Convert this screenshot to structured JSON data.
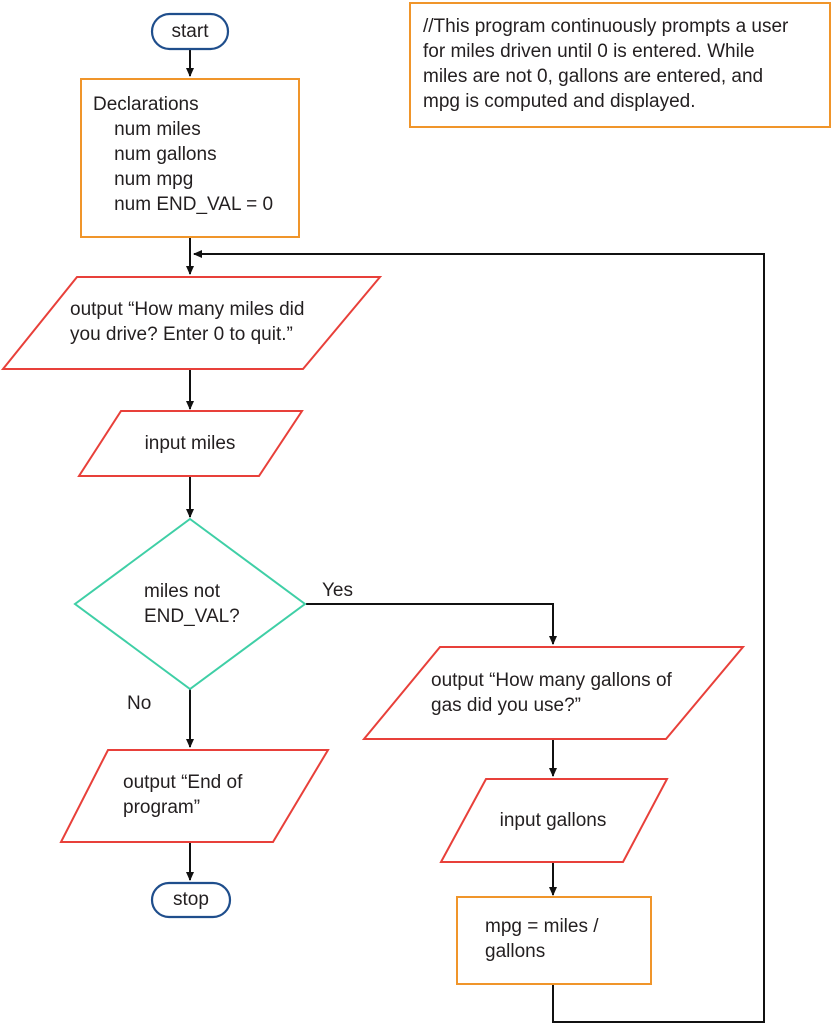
{
  "diagram": {
    "type": "flowchart",
    "colors": {
      "terminal": "#1f4e8c",
      "process": "#f0952a",
      "io": "#e8403a",
      "decision": "#3fcfa6",
      "connector": "#111111"
    },
    "comment": "//This program continuously prompts a user\nfor miles driven until 0 is entered. While\nmiles are not 0, gallons are entered, and\nmpg is computed and displayed.",
    "nodes": {
      "start": {
        "shape": "terminal",
        "text": "start"
      },
      "declarations": {
        "shape": "process",
        "text": "Declarations\n    num miles\n    num gallons\n    num mpg\n    num END_VAL = 0"
      },
      "prompt_miles": {
        "shape": "io",
        "text": "output “How many miles did\nyou drive? Enter 0 to quit.”"
      },
      "input_miles": {
        "shape": "io",
        "text": "input miles"
      },
      "decision": {
        "shape": "decision",
        "text": "miles not\nEND_VAL?"
      },
      "prompt_gallons": {
        "shape": "io",
        "text": "output “How many gallons of\ngas did you use?”"
      },
      "input_gallons": {
        "shape": "io",
        "text": "input gallons"
      },
      "compute": {
        "shape": "process",
        "text": "mpg = miles /\ngallons"
      },
      "end_output": {
        "shape": "io",
        "text": "output “End of\nprogram”"
      },
      "stop": {
        "shape": "terminal",
        "text": "stop"
      }
    },
    "edges": [
      {
        "from": "start",
        "to": "declarations"
      },
      {
        "from": "declarations",
        "to": "prompt_miles"
      },
      {
        "from": "prompt_miles",
        "to": "input_miles"
      },
      {
        "from": "input_miles",
        "to": "decision"
      },
      {
        "from": "decision",
        "to": "prompt_gallons",
        "label": "Yes"
      },
      {
        "from": "decision",
        "to": "end_output",
        "label": "No"
      },
      {
        "from": "prompt_gallons",
        "to": "input_gallons"
      },
      {
        "from": "input_gallons",
        "to": "compute"
      },
      {
        "from": "compute",
        "to": "prompt_miles",
        "label": ""
      },
      {
        "from": "end_output",
        "to": "stop"
      }
    ],
    "labels": {
      "yes": "Yes",
      "no": "No"
    }
  }
}
